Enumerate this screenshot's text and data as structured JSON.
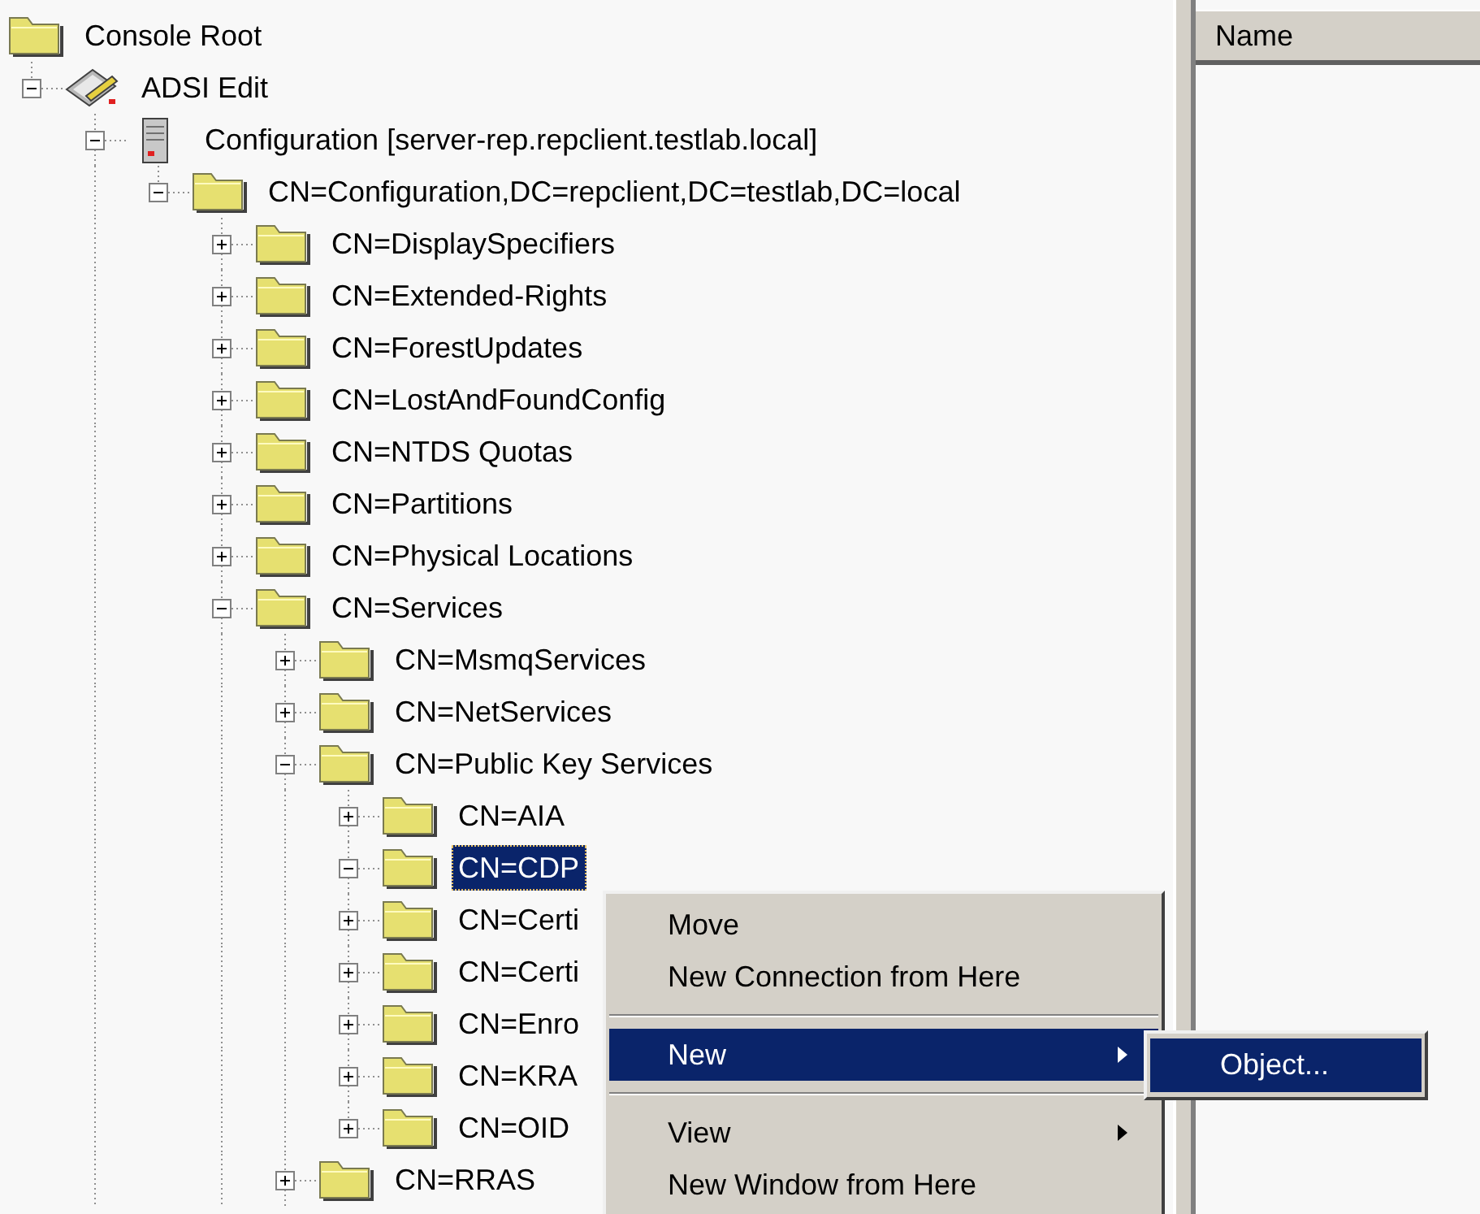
{
  "tree": {
    "label": "Console Root",
    "kind": "folder",
    "selected": false,
    "children": [
      {
        "label": "ADSI Edit",
        "kind": "adsi",
        "expanded": true,
        "selected": false,
        "children": [
          {
            "label": "Configuration [server-rep.repclient.testlab.local]",
            "kind": "server",
            "expanded": true,
            "continues": true,
            "selected": false,
            "children": [
              {
                "label": "CN=Configuration,DC=repclient,DC=testlab,DC=local",
                "kind": "folder",
                "expanded": true,
                "selected": false,
                "children": [
                  {
                    "label": "CN=DisplaySpecifiers",
                    "kind": "folder",
                    "expanded": false,
                    "selected": false
                  },
                  {
                    "label": "CN=Extended-Rights",
                    "kind": "folder",
                    "expanded": false,
                    "selected": false
                  },
                  {
                    "label": "CN=ForestUpdates",
                    "kind": "folder",
                    "expanded": false,
                    "selected": false
                  },
                  {
                    "label": "CN=LostAndFoundConfig",
                    "kind": "folder",
                    "expanded": false,
                    "selected": false
                  },
                  {
                    "label": "CN=NTDS Quotas",
                    "kind": "folder",
                    "expanded": false,
                    "selected": false
                  },
                  {
                    "label": "CN=Partitions",
                    "kind": "folder",
                    "expanded": false,
                    "selected": false
                  },
                  {
                    "label": "CN=Physical Locations",
                    "kind": "folder",
                    "expanded": false,
                    "selected": false
                  },
                  {
                    "label": "CN=Services",
                    "kind": "folder",
                    "expanded": true,
                    "continues": true,
                    "selected": false,
                    "children": [
                      {
                        "label": "CN=MsmqServices",
                        "kind": "folder",
                        "expanded": false,
                        "selected": false
                      },
                      {
                        "label": "CN=NetServices",
                        "kind": "folder",
                        "expanded": false,
                        "selected": false
                      },
                      {
                        "label": "CN=Public Key Services",
                        "kind": "folder",
                        "expanded": true,
                        "selected": false,
                        "children": [
                          {
                            "label": "CN=AIA",
                            "kind": "folder",
                            "expanded": false,
                            "selected": false
                          },
                          {
                            "label": "CN=CDP",
                            "kind": "folder",
                            "expanded": true,
                            "selected": true
                          },
                          {
                            "label": "CN=Certi",
                            "kind": "folder",
                            "expanded": false,
                            "selected": false
                          },
                          {
                            "label": "CN=Certi",
                            "kind": "folder",
                            "expanded": false,
                            "selected": false
                          },
                          {
                            "label": "CN=Enro",
                            "kind": "folder",
                            "expanded": false,
                            "selected": false
                          },
                          {
                            "label": "CN=KRA",
                            "kind": "folder",
                            "expanded": false,
                            "selected": false
                          },
                          {
                            "label": "CN=OID",
                            "kind": "folder",
                            "expanded": false,
                            "selected": false
                          }
                        ]
                      },
                      {
                        "label": "CN=RRAS",
                        "kind": "folder",
                        "expanded": false,
                        "continues": true,
                        "selected": false
                      }
                    ]
                  }
                ]
              }
            ]
          }
        ]
      }
    ]
  },
  "result_pane": {
    "columns": [
      {
        "label": "Name"
      }
    ]
  },
  "context_menu": {
    "items": [
      {
        "label": "Move",
        "kind": "command",
        "selected": false
      },
      {
        "label": "New Connection from Here",
        "kind": "command",
        "selected": false
      },
      {
        "kind": "separator"
      },
      {
        "label": "New",
        "kind": "submenu",
        "selected": true
      },
      {
        "kind": "separator"
      },
      {
        "label": "View",
        "kind": "submenu",
        "selected": false
      },
      {
        "label": "New Window from Here",
        "kind": "command",
        "selected": false
      }
    ]
  },
  "submenu": {
    "items": [
      {
        "label": "Object...",
        "selected": true
      }
    ]
  }
}
